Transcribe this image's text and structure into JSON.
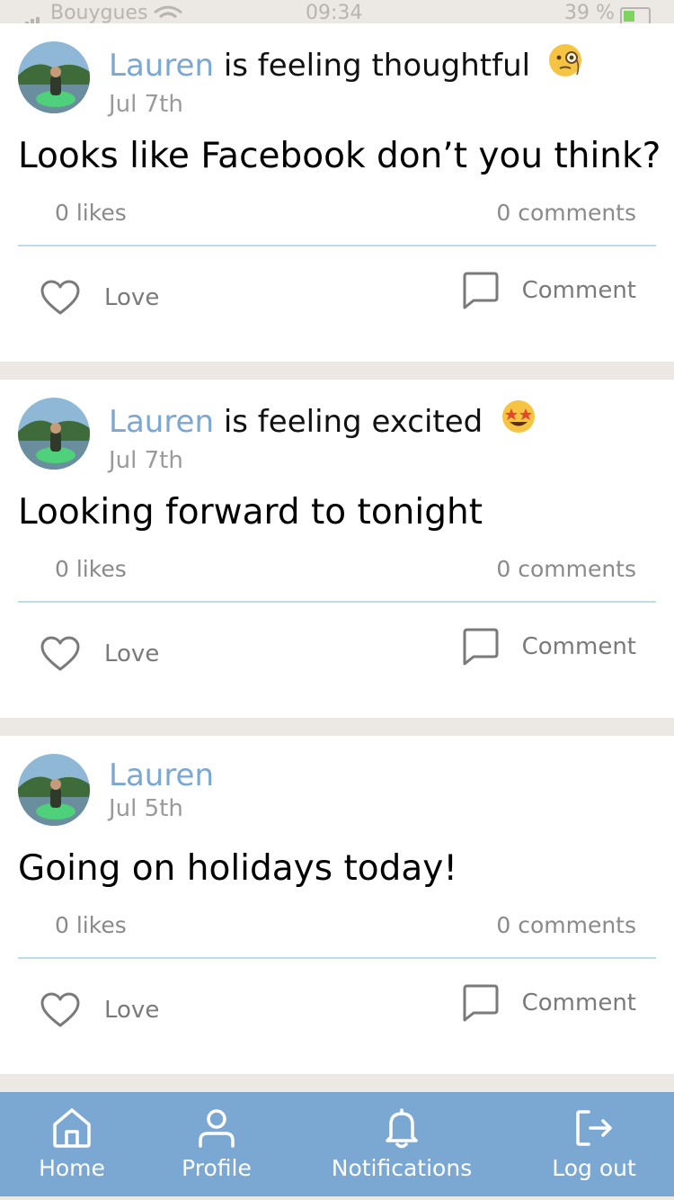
{
  "status_bar": {
    "carrier": "Bouygues",
    "time": "09:34",
    "battery": "39 %"
  },
  "posts": [
    {
      "author": "Lauren",
      "feeling": "is feeling thoughtful",
      "emoji": "monocle-face",
      "date": "Jul 7th",
      "text": "Looks like Facebook don’t you think?",
      "likes": "0 likes",
      "comments": "0 comments",
      "love_label": "Love",
      "comment_label": "Comment"
    },
    {
      "author": "Lauren",
      "feeling": "is feeling excited",
      "emoji": "star-struck-face",
      "date": "Jul 7th",
      "text": "Looking forward to tonight",
      "likes": "0 likes",
      "comments": "0 comments",
      "love_label": "Love",
      "comment_label": "Comment"
    },
    {
      "author": "Lauren",
      "feeling": "",
      "emoji": "",
      "date": "Jul 5th",
      "text": "Going on holidays today!",
      "likes": "0 likes",
      "comments": "0 comments",
      "love_label": "Love",
      "comment_label": "Comment"
    }
  ],
  "tabbar": {
    "home": "Home",
    "profile": "Profile",
    "notifications": "Notifications",
    "logout": "Log out"
  },
  "colors": {
    "accent": "#7ba7d3",
    "background": "#ece8e4",
    "divider": "#bddbe8"
  }
}
